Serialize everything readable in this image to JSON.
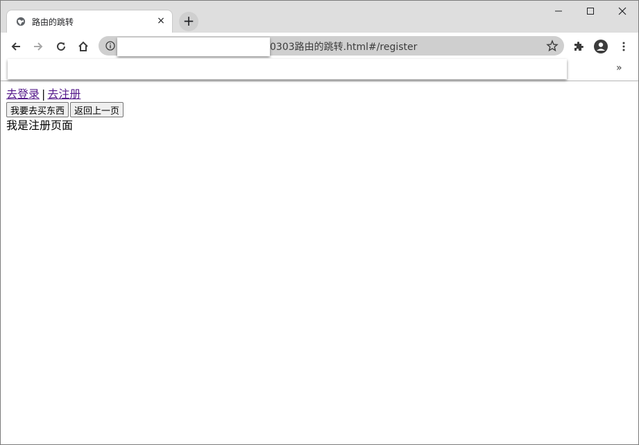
{
  "browser": {
    "tab_title": "路由的跳转",
    "tab_close": "×",
    "new_tab": "+",
    "url_visible": "0303路由的跳转.html#/register",
    "more_bookmarks": "»"
  },
  "icons": {
    "tab_favicon": "globe-icon",
    "back": "back-arrow-icon",
    "forward": "forward-arrow-icon",
    "reload": "reload-icon",
    "home": "home-icon",
    "info": "info-icon",
    "star": "star-icon",
    "extensions": "puzzle-icon",
    "profile": "profile-icon",
    "menu": "kebab-menu-icon"
  },
  "page": {
    "link_login": "去登录",
    "separator": "|",
    "link_register": "去注册",
    "btn_buy": "我要去买东西",
    "btn_back": "返回上一页",
    "content": "我是注册页面"
  }
}
